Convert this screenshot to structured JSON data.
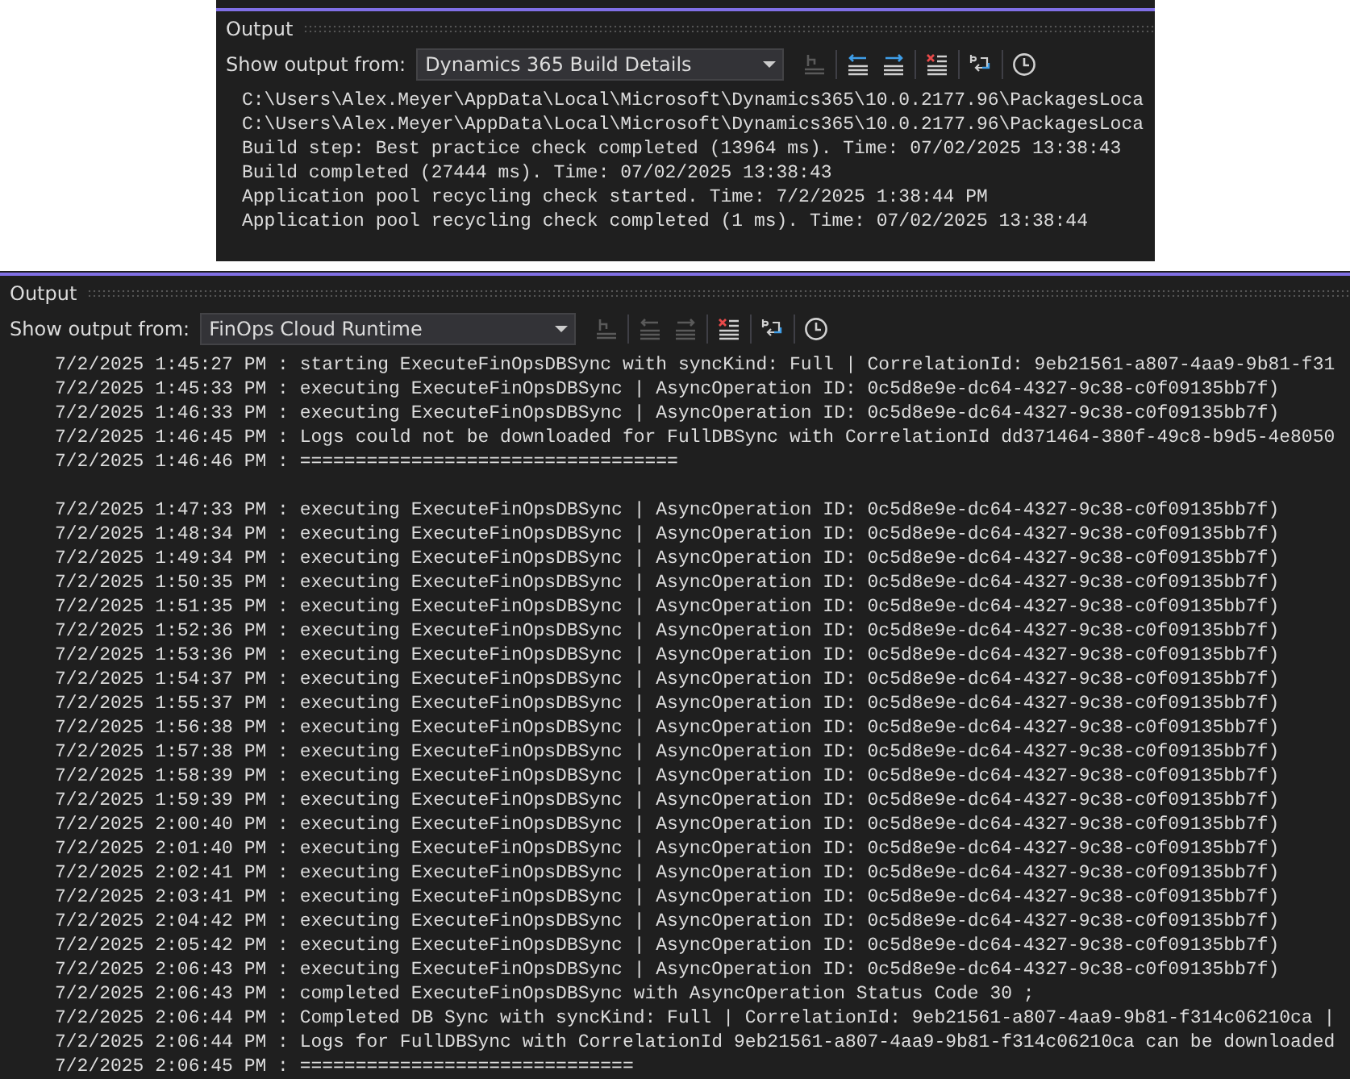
{
  "panels": [
    {
      "title": "Output",
      "source_label": "Show output from:",
      "source": "Dynamics 365 Build Details",
      "toolbar": [
        {
          "kind": "goto",
          "disabled": true
        },
        {
          "kind": "prev",
          "disabled": false
        },
        {
          "kind": "next",
          "disabled": false
        },
        {
          "kind": "clear",
          "disabled": false
        },
        {
          "kind": "wrap",
          "disabled": false
        },
        {
          "kind": "clock",
          "disabled": false
        }
      ],
      "line_groups": [
        [
          "C:\\Users\\Alex.Meyer\\AppData\\Local\\Microsoft\\Dynamics365\\10.0.2177.96\\PackagesLoca",
          "C:\\Users\\Alex.Meyer\\AppData\\Local\\Microsoft\\Dynamics365\\10.0.2177.96\\PackagesLoca",
          "Build step: Best practice check completed (13964 ms). Time: 07/02/2025 13:38:43",
          "Build completed (27444 ms). Time: 07/02/2025 13:38:43",
          "Application pool recycling check started. Time: 7/2/2025 1:38:44 PM",
          "Application pool recycling check completed (1 ms). Time: 07/02/2025 13:38:44"
        ]
      ]
    },
    {
      "title": "Output",
      "source_label": "Show output from:",
      "source": "FinOps Cloud Runtime",
      "toolbar": [
        {
          "kind": "goto",
          "disabled": true
        },
        {
          "kind": "prev",
          "disabled": true
        },
        {
          "kind": "next",
          "disabled": true
        },
        {
          "kind": "clear",
          "disabled": false
        },
        {
          "kind": "wrap",
          "disabled": false
        },
        {
          "kind": "clock",
          "disabled": false
        }
      ],
      "line_groups": [
        [
          "7/2/2025 1:45:27 PM : starting ExecuteFinOpsDBSync with syncKind: Full | CorrelationId: 9eb21561-a807-4aa9-9b81-f31",
          "7/2/2025 1:45:33 PM : executing ExecuteFinOpsDBSync | AsyncOperation ID: 0c5d8e9e-dc64-4327-9c38-c0f09135bb7f)",
          "7/2/2025 1:46:33 PM : executing ExecuteFinOpsDBSync | AsyncOperation ID: 0c5d8e9e-dc64-4327-9c38-c0f09135bb7f)",
          "7/2/2025 1:46:45 PM : Logs could not be downloaded for FullDBSync with CorrelationId dd371464-380f-49c8-b9d5-4e8050",
          "7/2/2025 1:46:46 PM : =================================="
        ],
        [
          "7/2/2025 1:47:33 PM : executing ExecuteFinOpsDBSync | AsyncOperation ID: 0c5d8e9e-dc64-4327-9c38-c0f09135bb7f)",
          "7/2/2025 1:48:34 PM : executing ExecuteFinOpsDBSync | AsyncOperation ID: 0c5d8e9e-dc64-4327-9c38-c0f09135bb7f)",
          "7/2/2025 1:49:34 PM : executing ExecuteFinOpsDBSync | AsyncOperation ID: 0c5d8e9e-dc64-4327-9c38-c0f09135bb7f)",
          "7/2/2025 1:50:35 PM : executing ExecuteFinOpsDBSync | AsyncOperation ID: 0c5d8e9e-dc64-4327-9c38-c0f09135bb7f)",
          "7/2/2025 1:51:35 PM : executing ExecuteFinOpsDBSync | AsyncOperation ID: 0c5d8e9e-dc64-4327-9c38-c0f09135bb7f)",
          "7/2/2025 1:52:36 PM : executing ExecuteFinOpsDBSync | AsyncOperation ID: 0c5d8e9e-dc64-4327-9c38-c0f09135bb7f)",
          "7/2/2025 1:53:36 PM : executing ExecuteFinOpsDBSync | AsyncOperation ID: 0c5d8e9e-dc64-4327-9c38-c0f09135bb7f)",
          "7/2/2025 1:54:37 PM : executing ExecuteFinOpsDBSync | AsyncOperation ID: 0c5d8e9e-dc64-4327-9c38-c0f09135bb7f)",
          "7/2/2025 1:55:37 PM : executing ExecuteFinOpsDBSync | AsyncOperation ID: 0c5d8e9e-dc64-4327-9c38-c0f09135bb7f)",
          "7/2/2025 1:56:38 PM : executing ExecuteFinOpsDBSync | AsyncOperation ID: 0c5d8e9e-dc64-4327-9c38-c0f09135bb7f)",
          "7/2/2025 1:57:38 PM : executing ExecuteFinOpsDBSync | AsyncOperation ID: 0c5d8e9e-dc64-4327-9c38-c0f09135bb7f)",
          "7/2/2025 1:58:39 PM : executing ExecuteFinOpsDBSync | AsyncOperation ID: 0c5d8e9e-dc64-4327-9c38-c0f09135bb7f)",
          "7/2/2025 1:59:39 PM : executing ExecuteFinOpsDBSync | AsyncOperation ID: 0c5d8e9e-dc64-4327-9c38-c0f09135bb7f)",
          "7/2/2025 2:00:40 PM : executing ExecuteFinOpsDBSync | AsyncOperation ID: 0c5d8e9e-dc64-4327-9c38-c0f09135bb7f)",
          "7/2/2025 2:01:40 PM : executing ExecuteFinOpsDBSync | AsyncOperation ID: 0c5d8e9e-dc64-4327-9c38-c0f09135bb7f)",
          "7/2/2025 2:02:41 PM : executing ExecuteFinOpsDBSync | AsyncOperation ID: 0c5d8e9e-dc64-4327-9c38-c0f09135bb7f)",
          "7/2/2025 2:03:41 PM : executing ExecuteFinOpsDBSync | AsyncOperation ID: 0c5d8e9e-dc64-4327-9c38-c0f09135bb7f)",
          "7/2/2025 2:04:42 PM : executing ExecuteFinOpsDBSync | AsyncOperation ID: 0c5d8e9e-dc64-4327-9c38-c0f09135bb7f)",
          "7/2/2025 2:05:42 PM : executing ExecuteFinOpsDBSync | AsyncOperation ID: 0c5d8e9e-dc64-4327-9c38-c0f09135bb7f)",
          "7/2/2025 2:06:43 PM : executing ExecuteFinOpsDBSync | AsyncOperation ID: 0c5d8e9e-dc64-4327-9c38-c0f09135bb7f)",
          "7/2/2025 2:06:43 PM : completed ExecuteFinOpsDBSync with AsyncOperation Status Code 30 ;",
          "7/2/2025 2:06:44 PM : Completed DB Sync with syncKind: Full | CorrelationId: 9eb21561-a807-4aa9-9b81-f314c06210ca |",
          "7/2/2025 2:06:44 PM : Logs for FullDBSync with CorrelationId 9eb21561-a807-4aa9-9b81-f314c06210ca can be downloaded",
          "7/2/2025 2:06:45 PM : =============================="
        ]
      ]
    }
  ]
}
